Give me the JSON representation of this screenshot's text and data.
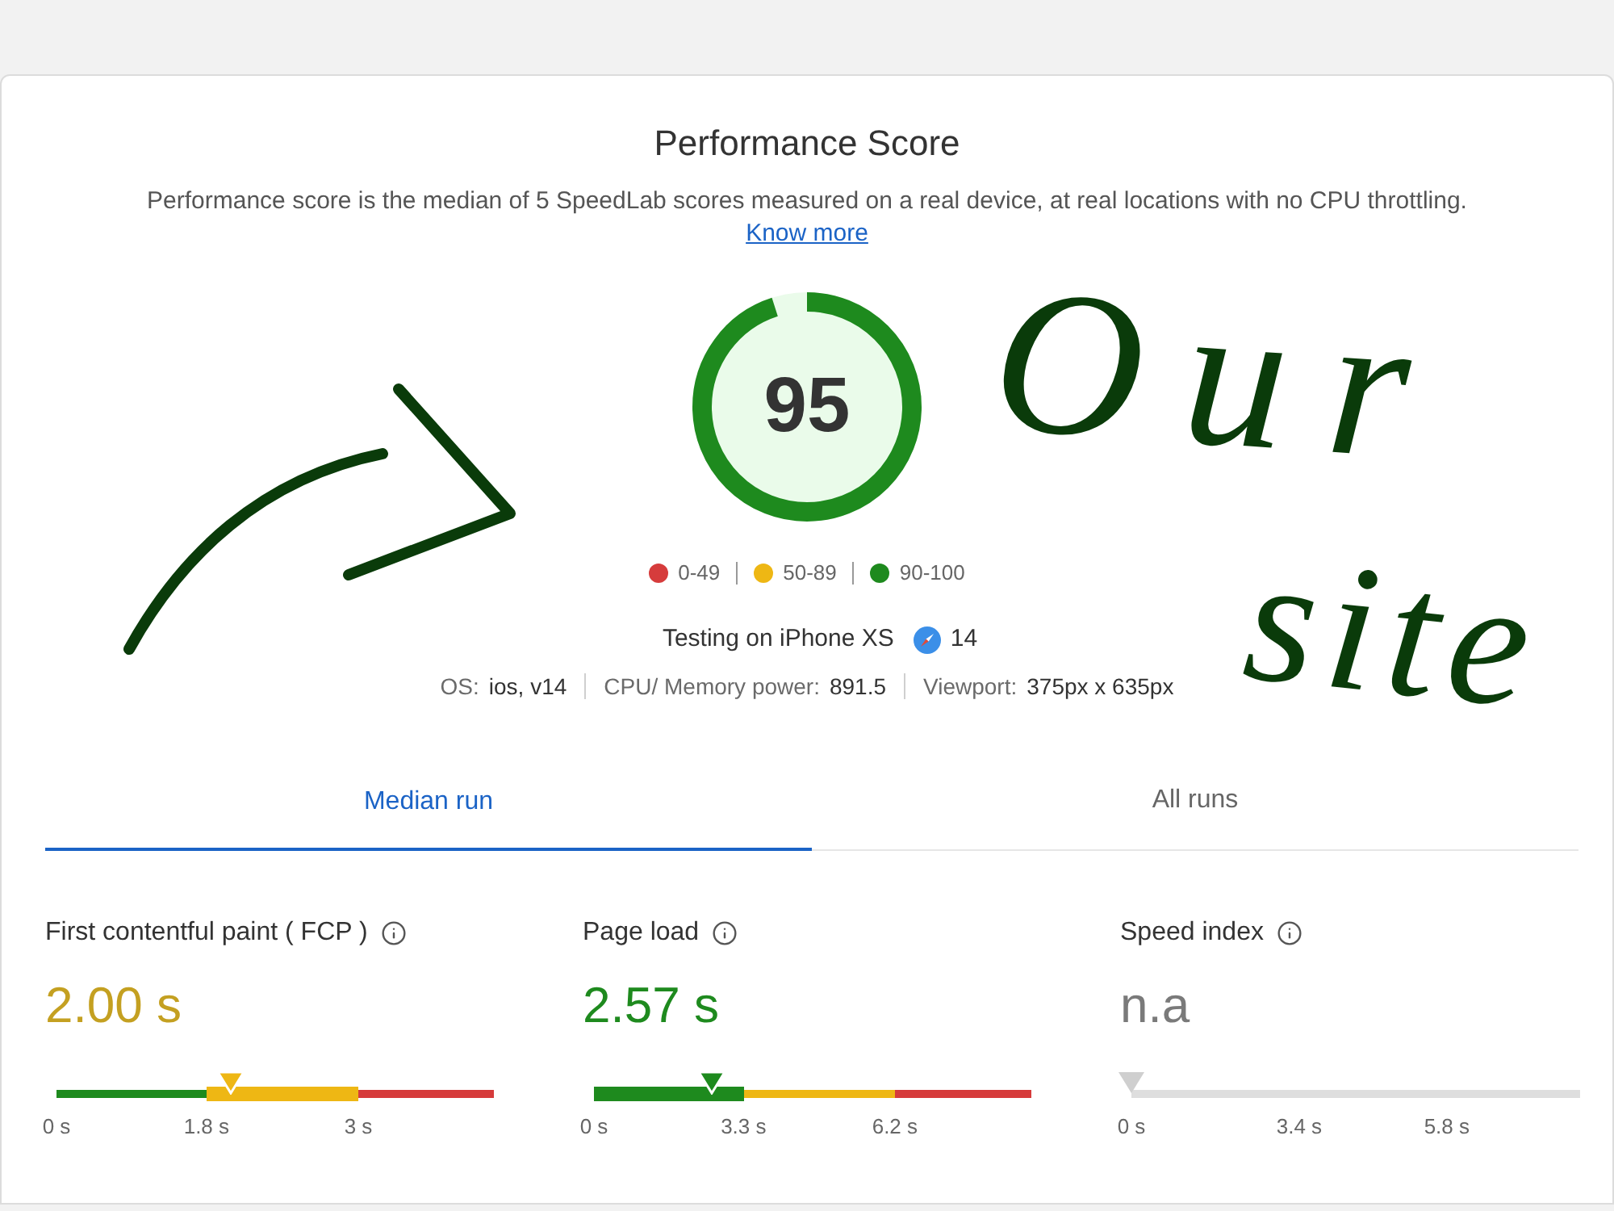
{
  "page_title": "Performance Score",
  "description": "Performance score is the median of 5 SpeedLab scores measured on a real device, at real locations with no CPU throttling.",
  "know_more_link": "Know more",
  "score": {
    "value": "95"
  },
  "legend": [
    {
      "label": "0-49",
      "color": "#d63c3c"
    },
    {
      "label": "50-89",
      "color": "#eeb714"
    },
    {
      "label": "90-100",
      "color": "#1e8a1e"
    }
  ],
  "device": {
    "text": "Testing on iPhone XS",
    "browser_version": "14"
  },
  "specs": [
    {
      "label": "OS:",
      "value": "ios, v14"
    },
    {
      "label": "CPU/ Memory power:",
      "value": "891.5"
    },
    {
      "label": "Viewport:",
      "value": "375px x 635px"
    }
  ],
  "tabs": [
    {
      "label": "Median run",
      "selected": true
    },
    {
      "label": "All runs",
      "selected": false
    }
  ],
  "metrics": [
    {
      "label": "First contentful paint ( FCP )",
      "value": "2.00 s",
      "kind": "average",
      "marker": {
        "level": 0.4
      },
      "scale": [
        {
          "label": "0 s",
          "level": 0
        },
        {
          "label": "1.8 s",
          "level": 0.343
        },
        {
          "label": "3 s",
          "level": 0.69
        }
      ]
    },
    {
      "label": "Page load",
      "value": "2.57 s",
      "kind": "good",
      "marker": {
        "level": 0.268
      },
      "scale": [
        {
          "label": "0 s",
          "level": 0
        },
        {
          "label": "3.3 s",
          "level": 0.342
        },
        {
          "label": "6.2 s",
          "level": 0.688
        }
      ]
    },
    {
      "label": "Speed index",
      "value": "n.a",
      "kind": "none",
      "marker": {
        "level": 0
      },
      "scale": [
        {
          "label": "0 s",
          "level": 0
        },
        {
          "label": "3.4 s",
          "level": 0.374
        },
        {
          "label": "5.8 s",
          "level": 0.703
        }
      ]
    }
  ],
  "annotations": [
    {
      "kind": "arrow"
    },
    {
      "kind": "note",
      "text": "Our"
    },
    {
      "kind": "note",
      "text": "site"
    }
  ]
}
